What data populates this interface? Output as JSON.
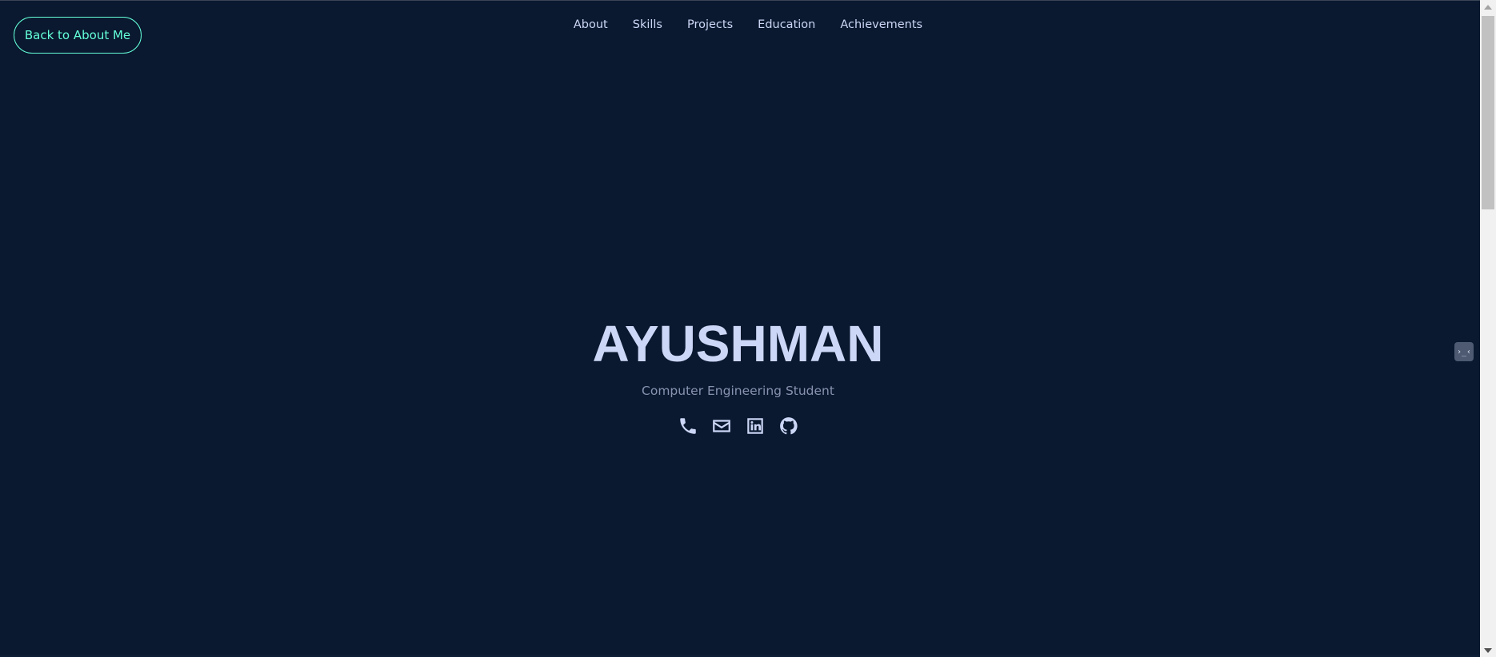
{
  "header": {
    "back_button_label": "Back to About Me",
    "nav": [
      {
        "label": "About"
      },
      {
        "label": "Skills"
      },
      {
        "label": "Projects"
      },
      {
        "label": "Education"
      },
      {
        "label": "Achievements"
      }
    ]
  },
  "hero": {
    "name": "AYUSHMAN",
    "subtitle": "Computer Engineering Student",
    "socials": [
      {
        "icon": "phone-icon"
      },
      {
        "icon": "email-icon"
      },
      {
        "icon": "linkedin-icon"
      },
      {
        "icon": "github-icon"
      }
    ]
  },
  "widget": {
    "glyph": "›_‹",
    "icon": "chat-widget-icon"
  },
  "colors": {
    "background": "#0a192f",
    "accent": "#64ffda",
    "text_primary": "#ccd6f6",
    "text_secondary": "#8892b0"
  }
}
